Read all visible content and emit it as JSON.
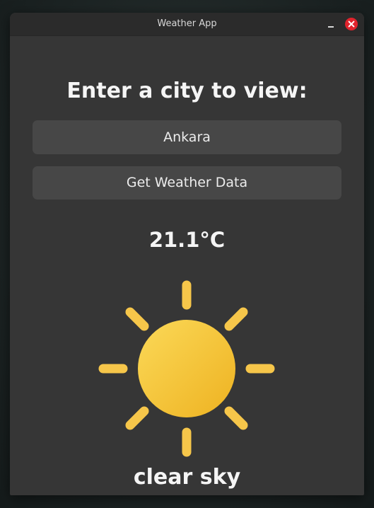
{
  "window": {
    "title": "Weather App"
  },
  "main": {
    "heading": "Enter a city to view:",
    "city_input": {
      "value": "Ankara",
      "placeholder": ""
    },
    "get_button_label": "Get Weather Data",
    "temperature": "21.1°C",
    "weather_icon": "sun-icon",
    "description": "clear sky"
  },
  "colors": {
    "window_bg": "#363636",
    "titlebar_bg": "#2b2b2b",
    "field_bg": "#474747",
    "text": "#f5f5f5",
    "close_button": "#e0232c",
    "sun_light": "#fbd958",
    "sun_dark": "#eeb221",
    "ray": "#f6c64a"
  }
}
